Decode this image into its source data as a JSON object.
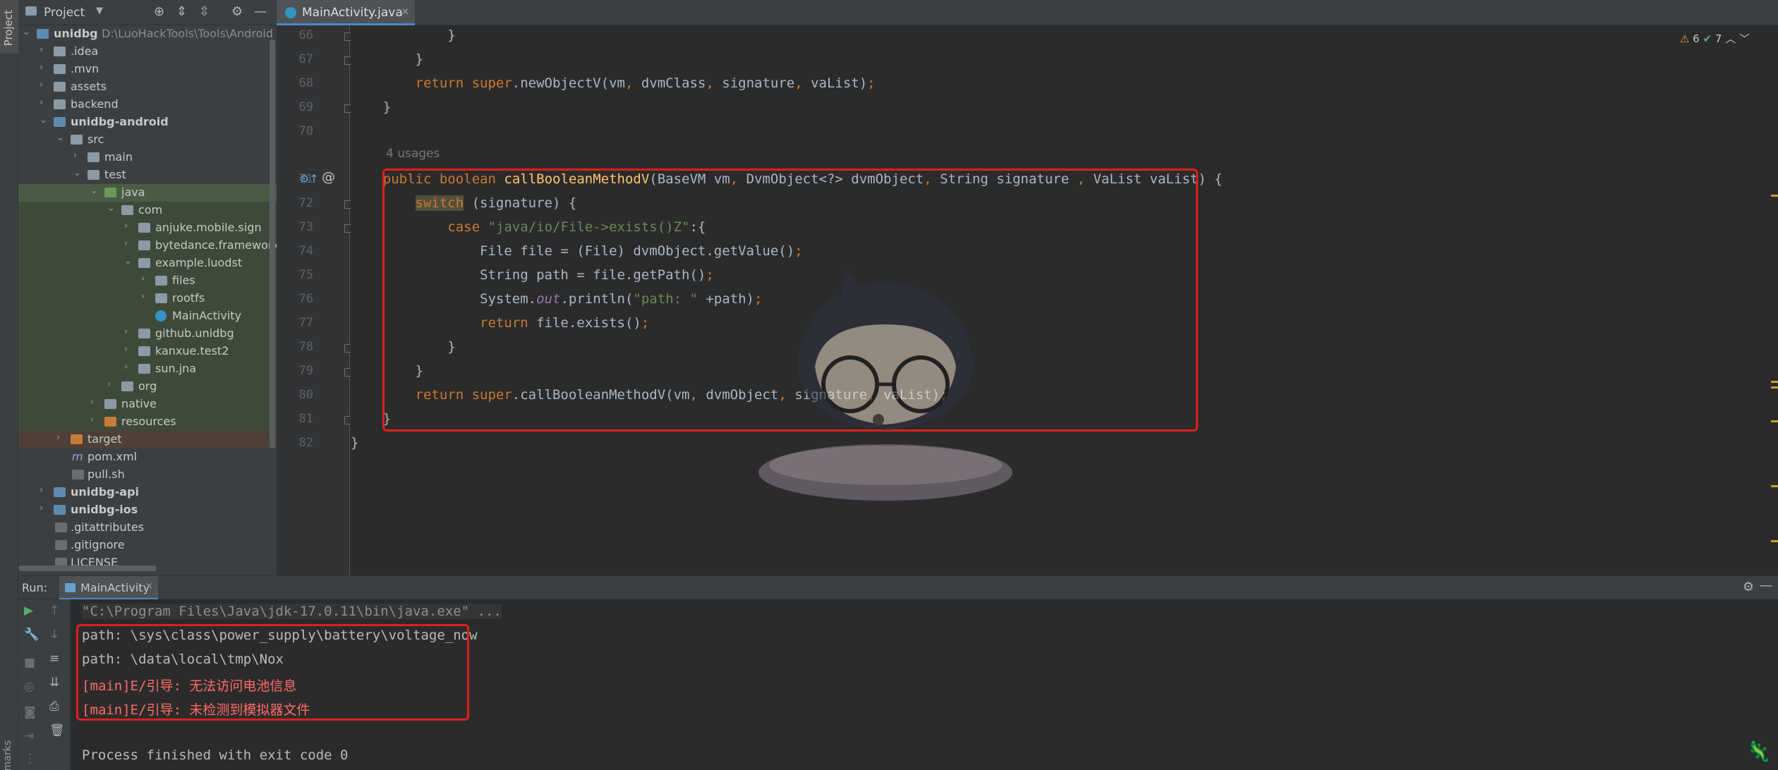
{
  "left_strip": {
    "project_label": "Project",
    "bookmarks_label": "Bookmarks"
  },
  "project_panel": {
    "title": "Project",
    "tree": [
      {
        "label": "unidbg",
        "path": "D:\\LuoHackTools\\Tools\\Android",
        "bold": true
      },
      {
        "label": ".idea"
      },
      {
        "label": ".mvn"
      },
      {
        "label": "assets"
      },
      {
        "label": "backend"
      },
      {
        "label": "unidbg-android",
        "bold": true
      },
      {
        "label": "src"
      },
      {
        "label": "main"
      },
      {
        "label": "test"
      },
      {
        "label": "java"
      },
      {
        "label": "com"
      },
      {
        "label": "anjuke.mobile.sign"
      },
      {
        "label": "bytedance.frameworks."
      },
      {
        "label": "example.luodst"
      },
      {
        "label": "files"
      },
      {
        "label": "rootfs"
      },
      {
        "label": "MainActivity"
      },
      {
        "label": "github.unidbg"
      },
      {
        "label": "kanxue.test2"
      },
      {
        "label": "sun.jna"
      },
      {
        "label": "org"
      },
      {
        "label": "native"
      },
      {
        "label": "resources"
      },
      {
        "label": "target"
      },
      {
        "label": "pom.xml"
      },
      {
        "label": "pull.sh"
      },
      {
        "label": "unidbg-api",
        "bold": true
      },
      {
        "label": "unidbg-ios",
        "bold": true
      },
      {
        "label": ".gitattributes"
      },
      {
        "label": ".gitignore"
      },
      {
        "label": "LICENSE"
      }
    ]
  },
  "editor": {
    "tab_label": "MainActivity.java",
    "warnings_count": "6",
    "ok_count": "7",
    "usages_hint": "4 usages",
    "line_numbers": [
      "66",
      "67",
      "68",
      "69",
      "70",
      "71",
      "72",
      "73",
      "74",
      "75",
      "76",
      "77",
      "78",
      "79",
      "80",
      "81",
      "82"
    ]
  },
  "run_panel": {
    "run_label": "Run:",
    "tab_label": "MainActivity",
    "console": {
      "command": "\"C:\\Program Files\\Java\\jdk-17.0.11\\bin\\java.exe\" ...",
      "line1": "path: \\sys\\class\\power_supply\\battery\\voltage_now",
      "line2": "path: \\data\\local\\tmp\\Nox",
      "line3": "[main]E/引导: 无法访问电池信息",
      "line4": "[main]E/引导: 未检测到模拟器文件",
      "finish": "Process finished with exit code 0"
    }
  },
  "colors": {
    "accent": "#4a88c7",
    "highlight_box": "#e01e1e",
    "keyword": "#cc7832",
    "string": "#6a8759",
    "error": "#ff6b68"
  }
}
